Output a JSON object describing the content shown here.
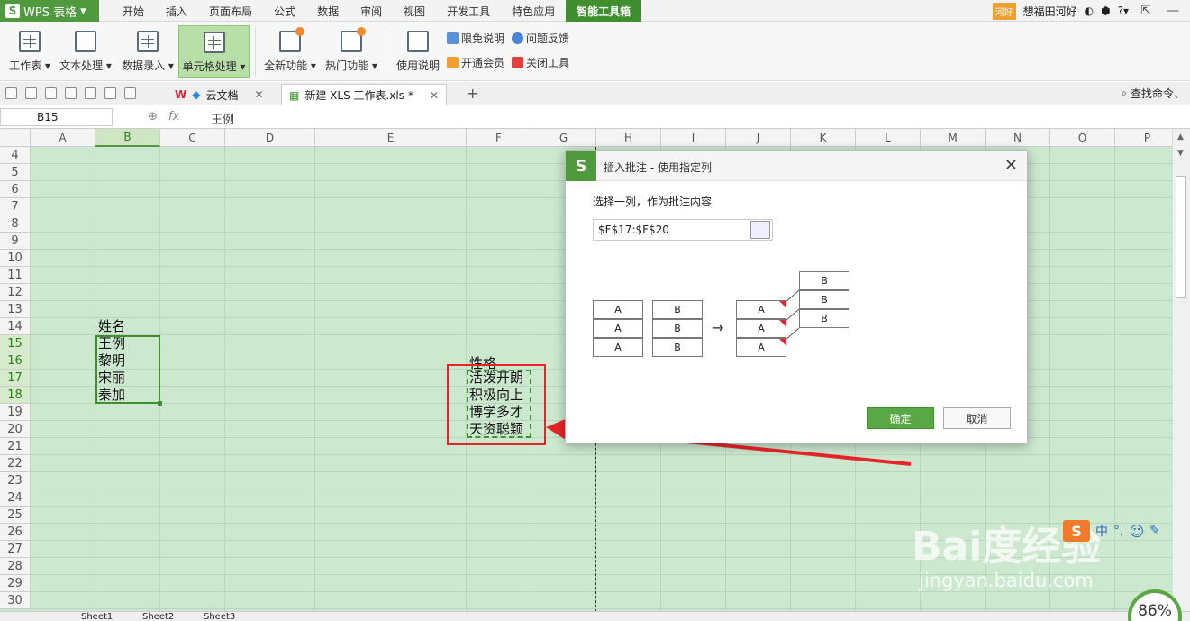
{
  "app": {
    "name": "WPS 表格",
    "logo": "S"
  },
  "menu": [
    "开始",
    "插入",
    "页面布局",
    "公式",
    "数据",
    "审阅",
    "视图",
    "开发工具",
    "特色应用",
    "智能工具箱"
  ],
  "user": {
    "badge": "河好",
    "name": "想福田河好"
  },
  "ribbon": {
    "buttons": [
      {
        "label": "工作表 ▾",
        "icon": "worksheet-icon"
      },
      {
        "label": "文本处理 ▾",
        "icon": "text-process-icon"
      },
      {
        "label": "数据录入 ▾",
        "icon": "data-entry-icon"
      },
      {
        "label": "单元格处理 ▾",
        "icon": "cell-process-icon"
      },
      {
        "label": "全新功能 ▾",
        "icon": "new-feature-icon"
      },
      {
        "label": "热门功能 ▾",
        "icon": "hot-feature-icon"
      },
      {
        "label": "使用说明",
        "icon": "manual-icon"
      }
    ],
    "small": {
      "disclaimer": "限免说明",
      "feedback": "问题反馈",
      "vip": "开通会员",
      "close_tools": "关闭工具"
    }
  },
  "doc_tabs": [
    {
      "label": "云文档"
    },
    {
      "label": "新建 XLS 工作表.xls *"
    }
  ],
  "search_cmd": "查找命令、",
  "namebox": "B15",
  "formula": "王例",
  "columns": [
    "A",
    "B",
    "C",
    "D",
    "E",
    "F",
    "G",
    "H",
    "I",
    "J",
    "K",
    "L",
    "M",
    "N",
    "O",
    "P"
  ],
  "rows": [
    "4",
    "5",
    "6",
    "7",
    "8",
    "9",
    "10",
    "11",
    "12",
    "13",
    "14",
    "15",
    "16",
    "17",
    "18",
    "19",
    "20",
    "21",
    "22",
    "23",
    "24",
    "25",
    "26",
    "27",
    "28",
    "29",
    "30"
  ],
  "cells": {
    "b14": "姓名",
    "b15": "王例",
    "b16": "黎明",
    "b17": "宋丽",
    "b18": "秦加",
    "f16": "性格",
    "f17": "活泼开朗",
    "f18": "积极向上",
    "f19": "博学多才",
    "f20": "天资聪颖"
  },
  "sheets": [
    "Sheet1",
    "Sheet2",
    "Sheet3"
  ],
  "dialog": {
    "logo": "S",
    "title": "插入批注 - 使用指定列",
    "prompt": "选择一列，作为批注内容",
    "range_value": "$F$17:$F$20",
    "ok": "确定",
    "cancel": "取消",
    "illustration": {
      "a": "A",
      "b": "B",
      "arrow": "→"
    }
  },
  "zoom": "86%",
  "watermark": {
    "brand": "Bai度经验",
    "url": "jingyan.baidu.com"
  },
  "colors": {
    "brand_green": "#4f9a3d",
    "grid_bg": "#cce8cf",
    "highlight_red": "#e8242a"
  }
}
